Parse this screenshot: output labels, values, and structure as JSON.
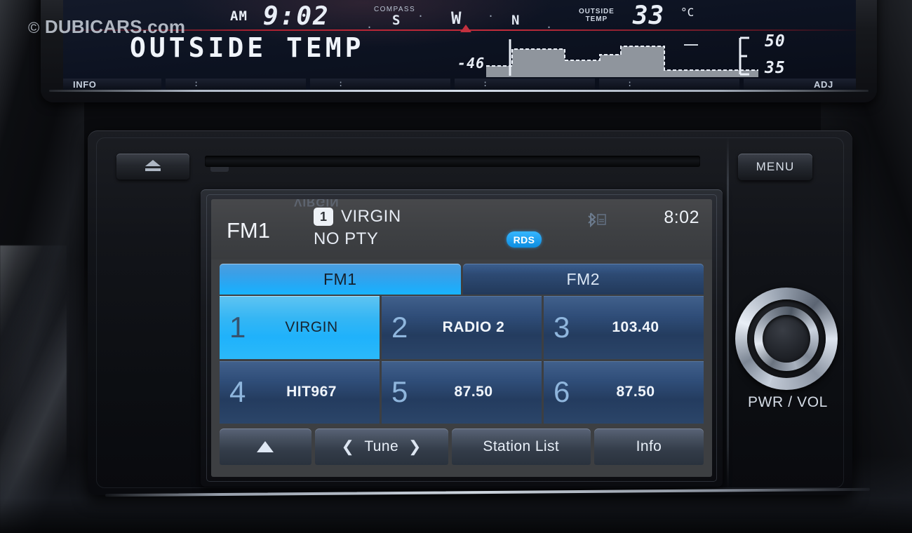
{
  "watermark": {
    "symbol": "©",
    "text": "DUBICARS.com"
  },
  "cluster": {
    "am_label": "AM",
    "time": "9:02",
    "compass_label": "COMPASS",
    "compass_points": [
      "S",
      "W",
      "N"
    ],
    "compass_dot": "·",
    "outside_temp_label_line1": "OUTSIDE",
    "outside_temp_label_line2": "TEMP",
    "temperature": "33",
    "temperature_unit": "°C",
    "main_message": "OUTSIDE TEMP",
    "graph_max": "50",
    "graph_mid": "35",
    "graph_low": "-46",
    "soft_buttons": [
      "INFO",
      "ADJ"
    ],
    "separator_marks": [
      ":",
      ":",
      ":",
      ":"
    ]
  },
  "head_unit": {
    "eject_label": "eject",
    "menu_label": "MENU",
    "knob_label": "PWR / VOL"
  },
  "screen": {
    "reflection_text": "VIRGIN",
    "band": "FM1",
    "current_preset_number": "1",
    "current_station": "VIRGIN",
    "program_type": "NO PTY",
    "rds_badge": "RDS",
    "bluetooth_icon": "bluetooth-icon",
    "clock": "8:02",
    "tabs": [
      {
        "label": "FM1",
        "active": true
      },
      {
        "label": "FM2",
        "active": false
      }
    ],
    "presets": [
      {
        "number": "1",
        "label": "VIRGIN",
        "selected": true
      },
      {
        "number": "2",
        "label": "RADIO 2",
        "selected": false
      },
      {
        "number": "3",
        "label": "103.40",
        "selected": false
      },
      {
        "number": "4",
        "label": "HIT967",
        "selected": false
      },
      {
        "number": "5",
        "label": "87.50",
        "selected": false
      },
      {
        "number": "6",
        "label": "87.50",
        "selected": false
      }
    ],
    "function_buttons": {
      "scroll_up": "▲",
      "tune_prev": "❮",
      "tune_label": "Tune",
      "tune_next": "❯",
      "station_list": "Station List",
      "info": "Info"
    }
  },
  "colors": {
    "accent_cyan": "#1fb2fb",
    "tab_active": "#25a8f5",
    "tab_idle": "#2d4a73",
    "rds_blue": "#0d8de0",
    "lcd_bg": "#3d3f42"
  }
}
